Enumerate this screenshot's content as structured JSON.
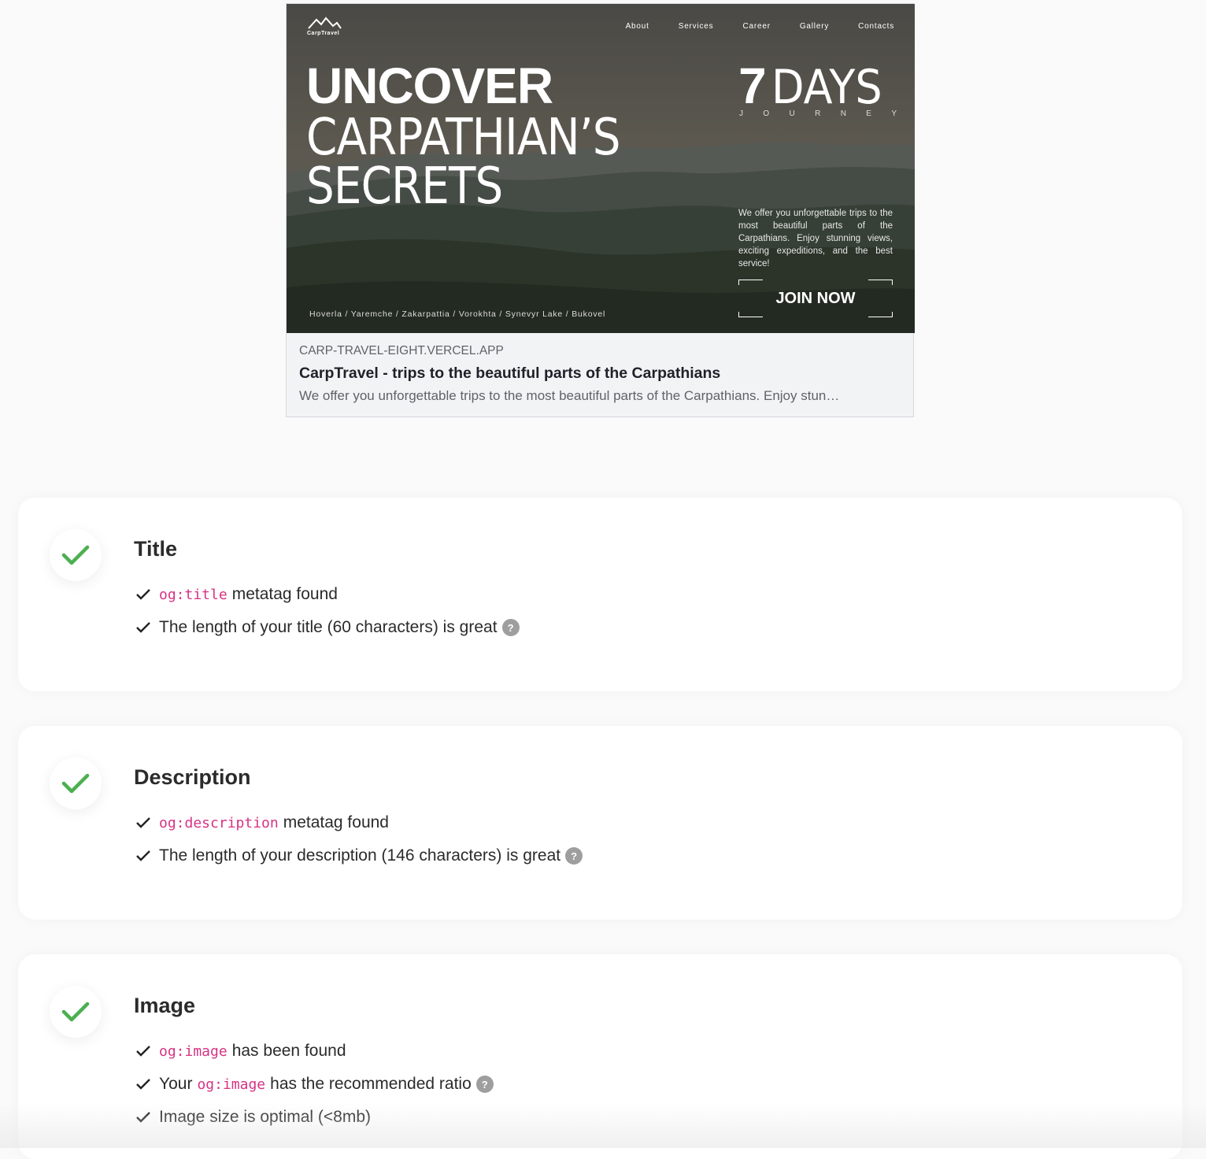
{
  "preview": {
    "logo_text": "CarpTravel",
    "nav": [
      "About",
      "Services",
      "Career",
      "Gallery",
      "Contacts"
    ],
    "headline_bold": "UNCOVER",
    "headline_line2": "CARPATHIAN’S",
    "headline_line3": "SECRETS",
    "days_number": "7",
    "days_word": "DAYS",
    "journey_letters": [
      "J",
      "O",
      "U",
      "R",
      "N",
      "E",
      "Y"
    ],
    "hero_description": "We offer you unforgettable trips to the most beautiful parts of the Carpathians. Enjoy stunning views, exciting expeditions, and the best service!",
    "join_label": "JOIN NOW",
    "locations": "Hoverla / Yaremche / Zakarpattia / Vorokhta / Synevyr Lake / Bukovel",
    "domain": "CARP-TRAVEL-EIGHT.VERCEL.APP",
    "title": "CarpTravel - trips to the beautiful parts of the Carpathians",
    "description": "We offer you unforgettable trips to the most beautiful parts of the Carpathians. Enjoy stun…"
  },
  "checks": {
    "title": {
      "heading": "Title",
      "item1_code": "og:title",
      "item1_text": "metatag found",
      "item2_text": "The length of your title (60 characters) is great"
    },
    "description": {
      "heading": "Description",
      "item1_code": "og:description",
      "item1_text": "metatag found",
      "item2_text": "The length of your description (146 characters) is great"
    },
    "image": {
      "heading": "Image",
      "item1_code": "og:image",
      "item1_text": "has been found",
      "item2_before": "Your",
      "item2_code": "og:image",
      "item2_text": "has the recommended ratio",
      "item3_text": "Image size is optimal (<8mb)"
    }
  },
  "help_glyph": "?",
  "icons": {
    "status": "check-icon",
    "item": "tick-icon",
    "help": "question-icon"
  },
  "colors": {
    "success_green": "#4caf50",
    "code_pink": "#d63384",
    "help_grey": "#9e9e9e"
  }
}
